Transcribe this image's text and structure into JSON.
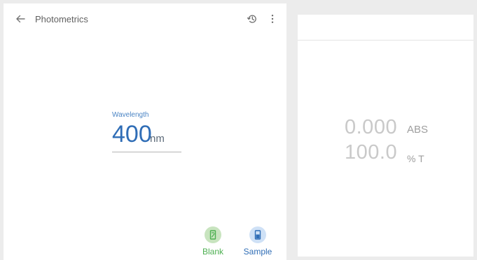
{
  "app": {
    "title": "Photometrics"
  },
  "icons": {
    "back": "arrow-left-icon",
    "history": "history-icon",
    "more": "more-vertical-icon",
    "blank": "blank-cuvette-icon",
    "sample": "sample-cuvette-icon"
  },
  "wavelength": {
    "label": "Wavelength",
    "value": "400",
    "unit": "nm"
  },
  "actions": {
    "blank": {
      "label": "Blank",
      "color": "#4caf50",
      "bg": "#c8e4bf"
    },
    "sample": {
      "label": "Sample",
      "color": "#2f6db6",
      "bg": "#cfe1f6"
    }
  },
  "readings": {
    "absorbance": {
      "value": "0.000",
      "unit": "ABS"
    },
    "transmittance": {
      "value": "100.0",
      "unit": "% T"
    }
  },
  "colors": {
    "accent": "#2f6db6",
    "background": "#ececec"
  }
}
